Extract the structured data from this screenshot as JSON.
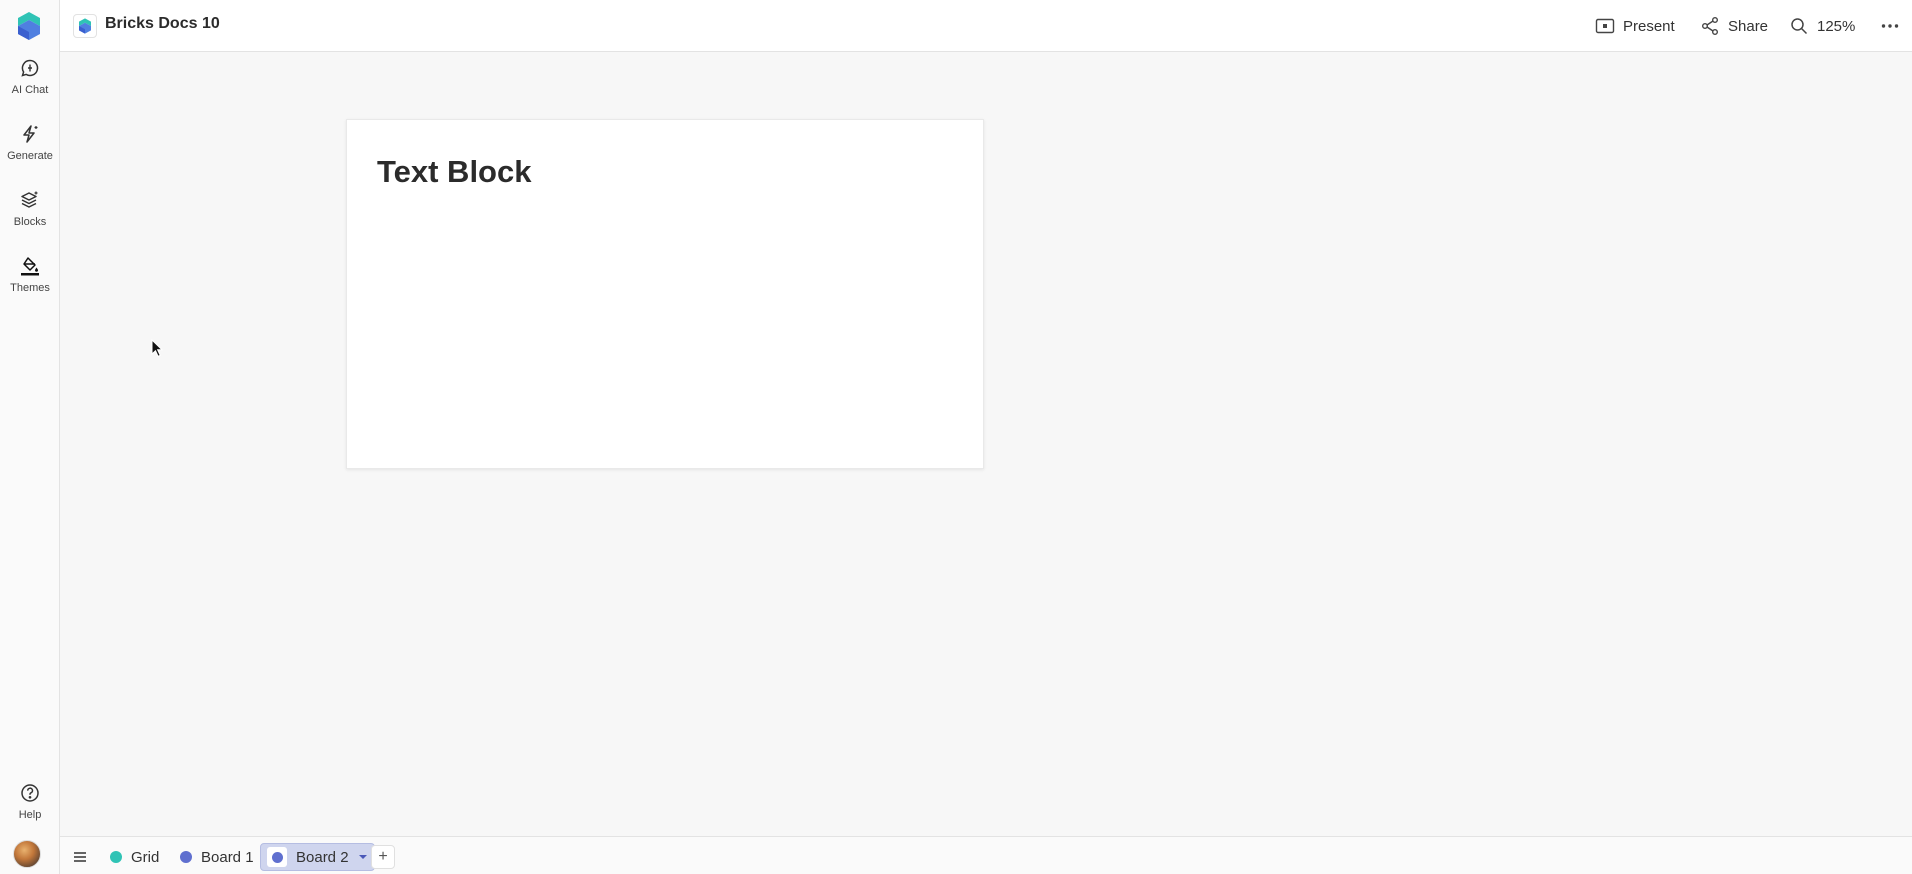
{
  "document": {
    "title": "Bricks Docs 10"
  },
  "sidebar": {
    "items": [
      {
        "label": "AI Chat",
        "icon": "chat-spark-icon"
      },
      {
        "label": "Generate",
        "icon": "bolt-sparkle-icon"
      },
      {
        "label": "Blocks",
        "icon": "layers-icon"
      },
      {
        "label": "Themes",
        "icon": "paint-bucket-icon"
      }
    ],
    "help_label": "Help"
  },
  "toolbar": {
    "present_label": "Present",
    "share_label": "Share",
    "zoom_label": "125%"
  },
  "canvas": {
    "block_heading": "Text Block"
  },
  "bottom": {
    "tabs": [
      {
        "label": "Grid",
        "color": "#2fc3b5",
        "active": false
      },
      {
        "label": "Board 1",
        "color": "#5f6fcf",
        "active": false
      },
      {
        "label": "Board 2",
        "color": "#5f6fcf",
        "active": true
      }
    ],
    "add_label": "+"
  },
  "colors": {
    "brand_teal": "#2fc3b5",
    "brand_indigo": "#5f6fcf",
    "active_tab_bg": "#cfd5ee"
  }
}
